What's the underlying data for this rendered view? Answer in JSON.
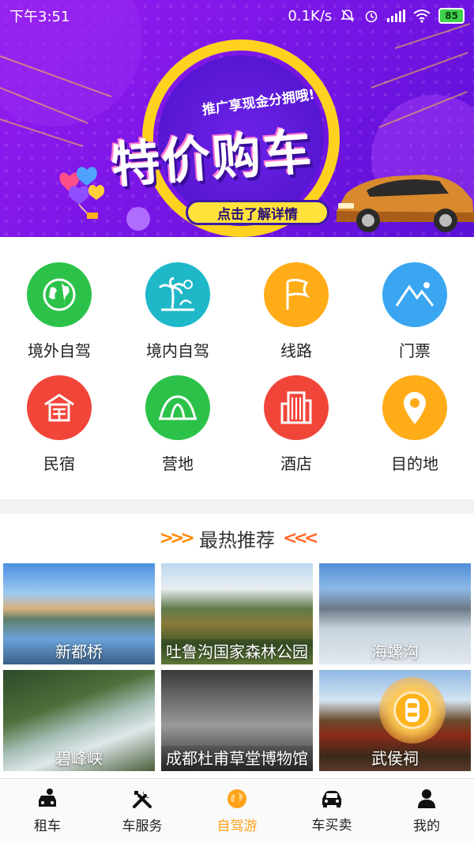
{
  "status_bar": {
    "time": "下午3:51",
    "speed": "0.1K/s",
    "battery": "85",
    "icons": [
      "alarm-off-icon",
      "alarm-icon",
      "signal-icon",
      "wifi-icon",
      "battery-icon"
    ]
  },
  "banner": {
    "promo": "推广享现金分拥哦!",
    "headline": "特价购车",
    "cta": "点击了解详情",
    "colors": {
      "bg": "#8a18ec",
      "ring": "#ffd21f",
      "cta": "#ffe23a"
    }
  },
  "categories": [
    {
      "label": "境外自驾",
      "icon": "globe-icon",
      "color": "#2cc24a"
    },
    {
      "label": "境内自驾",
      "icon": "palm-tree-icon",
      "color": "#1fb8c9"
    },
    {
      "label": "线路",
      "icon": "flag-icon",
      "color": "#ffac18"
    },
    {
      "label": "门票",
      "icon": "mountain-icon",
      "color": "#3aa6f2"
    },
    {
      "label": "民宿",
      "icon": "house-icon",
      "color": "#f2453a"
    },
    {
      "label": "营地",
      "icon": "tent-icon",
      "color": "#2cc24a"
    },
    {
      "label": "酒店",
      "icon": "building-icon",
      "color": "#f2453a"
    },
    {
      "label": "目的地",
      "icon": "location-pin-icon",
      "color": "#ffac18"
    }
  ],
  "hot": {
    "title": "最热推荐",
    "items": [
      {
        "caption": "新都桥"
      },
      {
        "caption": "吐鲁沟国家森林公园"
      },
      {
        "caption": "海螺沟"
      },
      {
        "caption": "碧峰峡"
      },
      {
        "caption": "成都杜甫草堂博物馆"
      },
      {
        "caption": "武侯祠"
      }
    ]
  },
  "nav": [
    {
      "label": "租车",
      "icon": "car-person-icon",
      "active": false
    },
    {
      "label": "车服务",
      "icon": "tools-icon",
      "active": false
    },
    {
      "label": "自驾游",
      "icon": "globe-icon",
      "active": true
    },
    {
      "label": "车买卖",
      "icon": "car-icon",
      "active": false
    },
    {
      "label": "我的",
      "icon": "user-icon",
      "active": false
    }
  ],
  "accent": "#ffa21a"
}
